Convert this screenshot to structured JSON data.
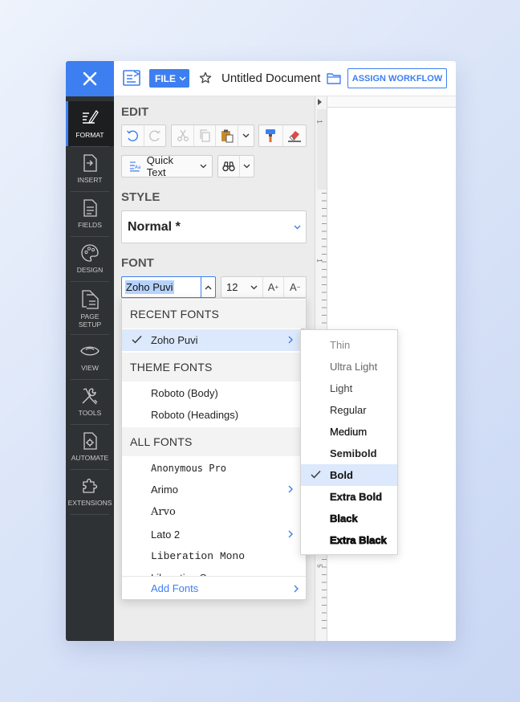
{
  "topbar": {
    "file_label": "FILE",
    "doc_title": "Untitled Document",
    "assign_label": "ASSIGN WORKFLOW"
  },
  "rail": {
    "items": [
      {
        "label": "FORMAT",
        "icon": "format-icon"
      },
      {
        "label": "INSERT",
        "icon": "insert-icon"
      },
      {
        "label": "FIELDS",
        "icon": "fields-icon"
      },
      {
        "label": "DESIGN",
        "icon": "palette-icon"
      },
      {
        "label": "PAGE",
        "label2": "SETUP",
        "icon": "page-setup-icon"
      },
      {
        "label": "VIEW",
        "icon": "eye-icon"
      },
      {
        "label": "TOOLS",
        "icon": "tools-icon"
      },
      {
        "label": "AUTOMATE",
        "icon": "automate-icon"
      },
      {
        "label": "EXTENSIONS",
        "icon": "puzzle-icon"
      }
    ]
  },
  "panel": {
    "edit_title": "EDIT",
    "quick_text": "Quick Text",
    "style_title": "STYLE",
    "style_value": "Normal *",
    "font_title": "FONT",
    "font_value": "Zoho Puvi",
    "size_value": "12",
    "grow_label": "A",
    "shrink_label": "A"
  },
  "font_dropdown": {
    "recent_header": "RECENT FONTS",
    "recent": [
      "Zoho Puvi"
    ],
    "theme_header": "THEME FONTS",
    "theme": [
      "Roboto (Body)",
      "Roboto (Headings)"
    ],
    "all_header": "ALL FONTS",
    "all": [
      "Anonymous Pro",
      "Arimo",
      "Arvo",
      "Lato 2",
      "Liberation Mono",
      "Liberation Sans"
    ],
    "footer": "Add Fonts"
  },
  "weights": [
    "Thin",
    "Ultra Light",
    "Light",
    "Regular",
    "Medium",
    "Semibold",
    "Bold",
    "Extra Bold",
    "Black",
    "Extra Black"
  ],
  "selected_weight": "Bold",
  "ruler": {
    "mark1": "1",
    "mark5": "5"
  },
  "colors": {
    "accent": "#3d7ff0",
    "rail": "#2f3235",
    "selection": "#dce8fb"
  }
}
